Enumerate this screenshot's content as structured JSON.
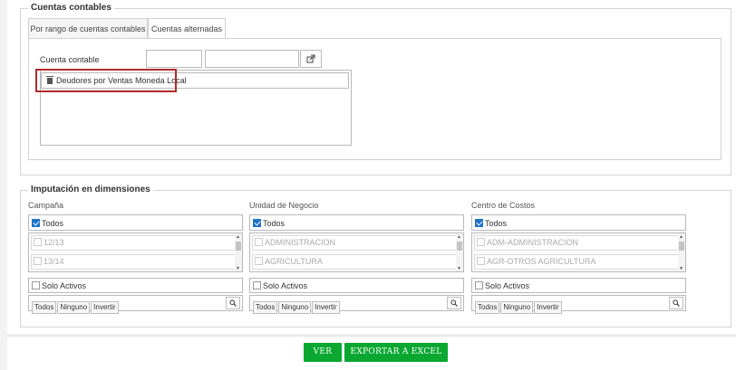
{
  "cuentas": {
    "legend": "Cuentas contables",
    "tabs": [
      {
        "label": "Por rango de cuentas contables"
      },
      {
        "label": "Cuentas alternadas"
      }
    ],
    "cuenta_label": "Cuenta contable",
    "code_value": "",
    "name_value": "",
    "selected_item": "Deudores por Ventas Moneda Local"
  },
  "dimensiones": {
    "legend": "Imputación en dimensiones",
    "columns": [
      {
        "title": "Campaña",
        "todos_label": "Todos",
        "options": [
          "12/13",
          "13/14"
        ],
        "solo_activos": "Solo Activos",
        "buttons": [
          "Todos",
          "Ninguno",
          "Invertir"
        ]
      },
      {
        "title": "Unidad de Negocio",
        "todos_label": "Todos",
        "options": [
          "ADMINISTRACION",
          "AGRICULTURA"
        ],
        "solo_activos": "Solo Activos",
        "buttons": [
          "Todos",
          "Ninguno",
          "Invertir"
        ]
      },
      {
        "title": "Centro de Costos",
        "todos_label": "Todos",
        "options": [
          "ADM-ADMINISTRACION",
          "AGR-OTROS AGRICULTURA"
        ],
        "solo_activos": "Solo Activos",
        "buttons": [
          "Todos",
          "Ninguno",
          "Invertir"
        ]
      }
    ]
  },
  "actions": {
    "ver": "VER",
    "exportar": "EXPORTAR A EXCEL"
  },
  "colors": {
    "accent_green": "#0aa830",
    "checkbox_blue": "#1e73c8",
    "highlight_red": "#b22b2b"
  }
}
